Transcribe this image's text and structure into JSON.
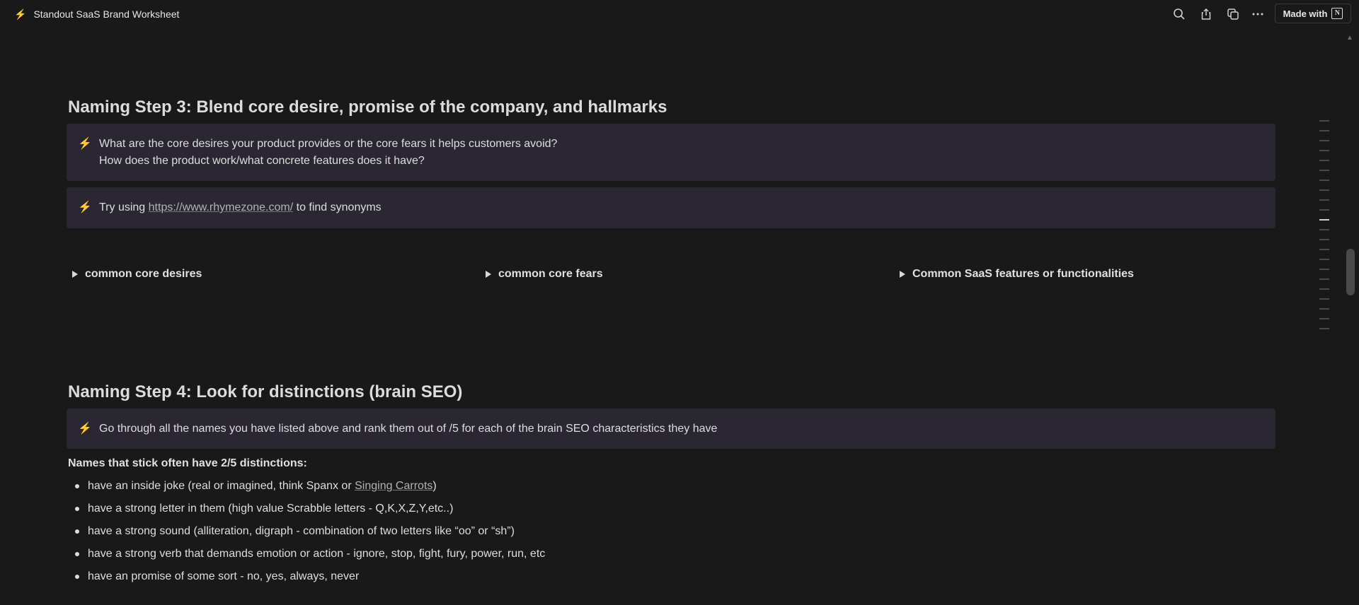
{
  "topbar": {
    "icon": "lightning-icon",
    "title": "Standout SaaS Brand Worksheet",
    "made_with": "Made with"
  },
  "sections": {
    "step3": {
      "heading": "Naming Step 3: Blend core desire,  promise of the company, and hallmarks",
      "callout1": {
        "line1": "What are the core desires your product provides or the core fears it helps customers avoid?",
        "line2": "How does the product work/what concrete features does it have?"
      },
      "callout2": {
        "before": "Try using ",
        "link": "https://www.rhymezone.com/",
        "after": " to find synonyms"
      },
      "toggles": [
        "common core desires",
        "common core fears",
        "Common SaaS features or functionalities"
      ]
    },
    "step4": {
      "heading": "Naming Step 4: Look for distinctions (brain SEO)",
      "callout": "Go through all the names you have listed above and rank them out of /5 for each of the brain SEO characteristics they have",
      "subheading": "Names that stick often have 2/5 distinctions:",
      "bullet1_before": "have an inside joke (real or imagined, think Spanx or ",
      "bullet1_link": "Singing Carrots",
      "bullet1_after": ")",
      "bullet2": "have a strong letter in them (high value Scrabble letters - Q,K,X,Z,Y,etc..)",
      "bullet3": "have a strong sound (alliteration, digraph - combination of two letters like “oo” or “sh”)",
      "bullet4": "have a strong verb that demands emotion or action - ignore, stop, fight, fury, power, run, etc",
      "bullet5": "have an promise of some sort - no, yes, always, never"
    }
  },
  "colors": {
    "background": "#191919",
    "callout_bg": "#2a2632",
    "accent_bolt": "#f3c22b"
  }
}
